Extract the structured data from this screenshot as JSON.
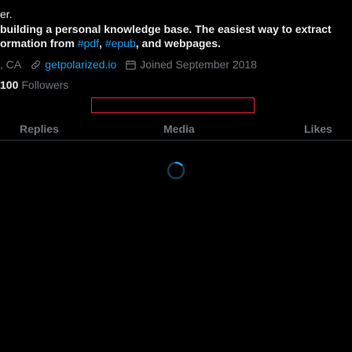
{
  "profile": {
    "name_fragment": "er.",
    "bio": {
      "line1": "building a personal knowledge base. The easiest way to extract",
      "line2_prefix": "ormation from ",
      "hashtag_pdf": "#pdf",
      "sep1": ", ",
      "hashtag_epub": "#epub",
      "line2_suffix": ", and webpages."
    },
    "location": ", CA",
    "website": "getpolarized.io",
    "joined": "Joined September 2018",
    "followers_count": "100",
    "followers_label": "Followers"
  },
  "tabs": [
    {
      "label": "Replies"
    },
    {
      "label": "Media"
    },
    {
      "label": "Likes"
    }
  ],
  "icons": {
    "link": "link-icon",
    "calendar": "calendar-icon",
    "spinner": "loading-spinner-icon"
  },
  "colors": {
    "background": "#000000",
    "text": "#e7e9ea",
    "muted": "#71767b",
    "accent": "#1d9bf0",
    "highlight_box": "#f4212e"
  }
}
